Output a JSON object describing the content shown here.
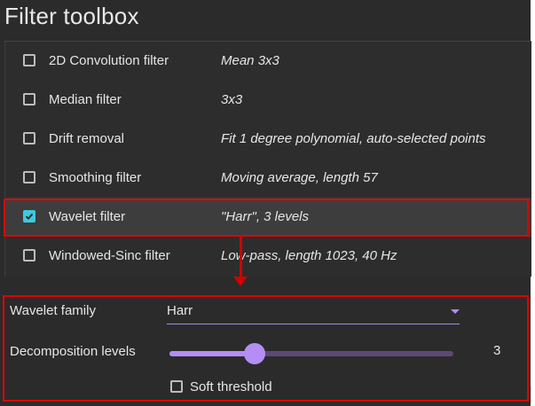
{
  "window": {
    "title": "Filter toolbox"
  },
  "filters": [
    {
      "name": "2D Convolution filter",
      "description": "Mean 3x3",
      "checked": false,
      "selected": false
    },
    {
      "name": "Median filter",
      "description": "3x3",
      "checked": false,
      "selected": false
    },
    {
      "name": "Drift removal",
      "description": "Fit 1 degree polynomial, auto-selected points",
      "checked": false,
      "selected": false
    },
    {
      "name": "Smoothing filter",
      "description": "Moving average, length 57",
      "checked": false,
      "selected": false
    },
    {
      "name": "Wavelet filter",
      "description": "\"Harr\", 3 levels",
      "checked": true,
      "selected": true
    },
    {
      "name": "Windowed-Sinc filter",
      "description": "Low-pass, length 1023, 40 Hz",
      "checked": false,
      "selected": false
    }
  ],
  "params": {
    "family_label": "Wavelet family",
    "family_value": "Harr",
    "levels_label": "Decomposition levels",
    "levels_value": "3",
    "levels_fraction": 0.3,
    "soft_threshold_label": "Soft threshold",
    "soft_threshold_checked": false
  },
  "colors": {
    "accent": "#b48ef5",
    "check": "#3ec9dd",
    "highlight": "#e00000"
  }
}
